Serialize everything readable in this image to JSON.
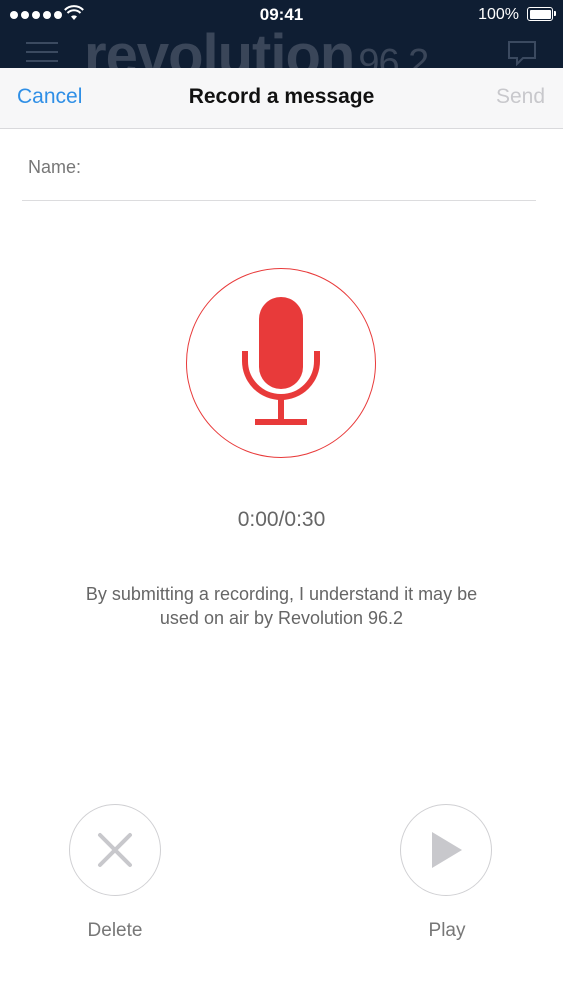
{
  "status_bar": {
    "time": "09:41",
    "battery_percent": "100%",
    "signal_icon": "signal-dots-icon",
    "wifi_icon": "wifi-icon",
    "battery_icon": "battery-icon"
  },
  "app_header": {
    "brand_name": "revolution",
    "brand_frequency": "96.2",
    "menu_icon": "hamburger-icon",
    "chat_icon": "chat-bubble-icon"
  },
  "nav": {
    "cancel_label": "Cancel",
    "title": "Record a message",
    "send_label": "Send"
  },
  "form": {
    "name_label": "Name:",
    "name_value": "",
    "name_placeholder": ""
  },
  "recorder": {
    "mic_icon": "microphone-icon",
    "accent_color": "#e83a3a",
    "timer": "0:00/0:30",
    "disclaimer": "By submitting a recording, I understand it may be used on air by Revolution 96.2"
  },
  "controls": {
    "delete_label": "Delete",
    "delete_icon": "close-icon",
    "play_label": "Play",
    "play_icon": "play-icon"
  }
}
